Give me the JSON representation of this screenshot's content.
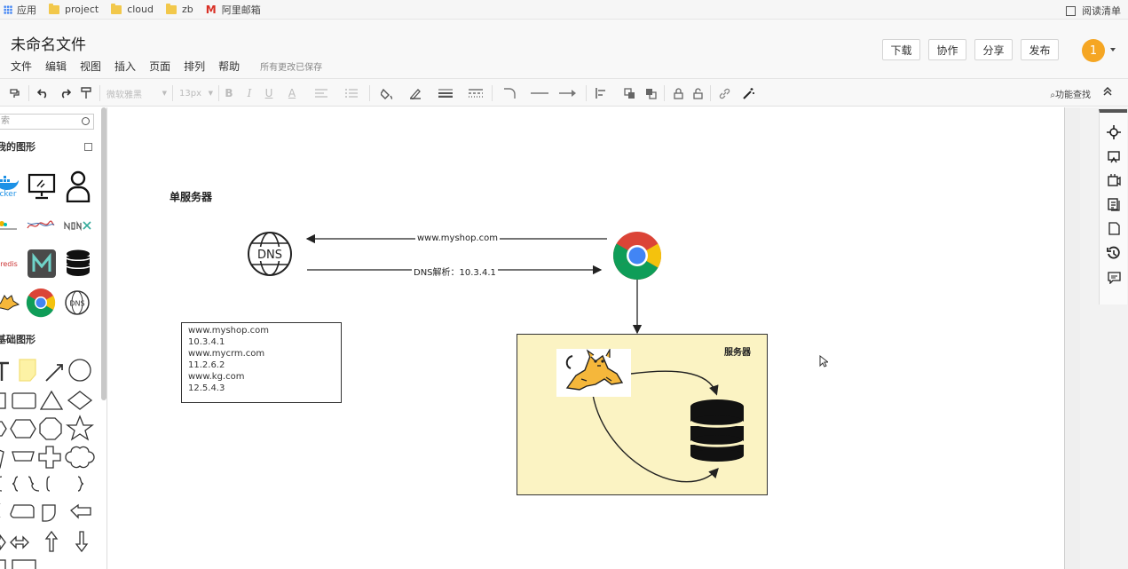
{
  "bookmarks": {
    "items": [
      {
        "label": "应用",
        "icon": "apps-icon"
      },
      {
        "label": "project",
        "icon": "folder-icon"
      },
      {
        "label": "cloud",
        "icon": "folder-icon"
      },
      {
        "label": "zb",
        "icon": "folder-icon"
      },
      {
        "label": "阿里邮箱",
        "icon": "gmail-icon"
      }
    ],
    "reading_list": "阅读清单"
  },
  "header": {
    "title": "未命名文件",
    "menu": [
      "文件",
      "编辑",
      "视图",
      "插入",
      "页面",
      "排列",
      "帮助"
    ],
    "save_status": "所有更改已保存",
    "buttons": {
      "download": "下载",
      "collaborate": "协作",
      "share": "分享",
      "publish": "发布"
    },
    "avatar": "1"
  },
  "toolbar": {
    "font_family": "微软雅黑",
    "font_size": "13px",
    "find_function": "功能查找"
  },
  "left_panel": {
    "search_placeholder": "索",
    "my_shapes": "我的图形",
    "my_shape_labels": {
      "docker": "cker",
      "redis": "redis"
    },
    "basic_shapes": "基础图形"
  },
  "diagram": {
    "heading": "单服务器",
    "dns_node_label": "DNS",
    "edge_request": "www.myshop.com",
    "edge_response": "DNS解析：10.3.4.1",
    "dns_records": [
      "www.myshop.com",
      "10.3.4.1",
      "www.mycrm.com",
      "11.2.6.2",
      "www.kg.com",
      "12.5.4.3"
    ],
    "server_label": "服务器"
  },
  "colors": {
    "avatar": "#f5a623",
    "server_box_fill": "#fbf3c3",
    "tomcat": "#f5b73b",
    "chrome_red": "#db4437",
    "chrome_yellow": "#f4c20d",
    "chrome_green": "#0f9d58",
    "chrome_blue": "#4285f4"
  }
}
